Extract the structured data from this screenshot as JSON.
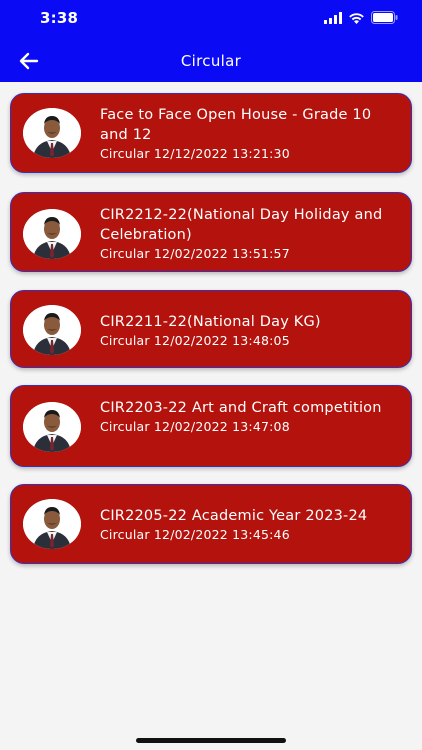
{
  "status_bar": {
    "time": "3:38"
  },
  "nav": {
    "title": "Circular",
    "back_icon": "back-arrow-icon"
  },
  "circulars": [
    {
      "title": "Face to Face Open House - Grade 10 and 12",
      "meta": "Circular 12/12/2022 13:21:30"
    },
    {
      "title": "CIR2212-22(National Day Holiday and Celebration)",
      "meta": "Circular 12/02/2022 13:51:57"
    },
    {
      "title": "CIR2211-22(National Day KG)",
      "meta": "Circular 12/02/2022 13:48:05"
    },
    {
      "title": "CIR2203-22 Art and Craft competition",
      "meta": "Circular 12/02/2022 13:47:08"
    },
    {
      "title": "CIR2205-22 Academic Year 2023-24",
      "meta": "Circular 12/02/2022 13:45:46"
    }
  ],
  "colors": {
    "header": "#0a0af5",
    "card": "#b3120d",
    "card_border": "#3b2fb8"
  }
}
